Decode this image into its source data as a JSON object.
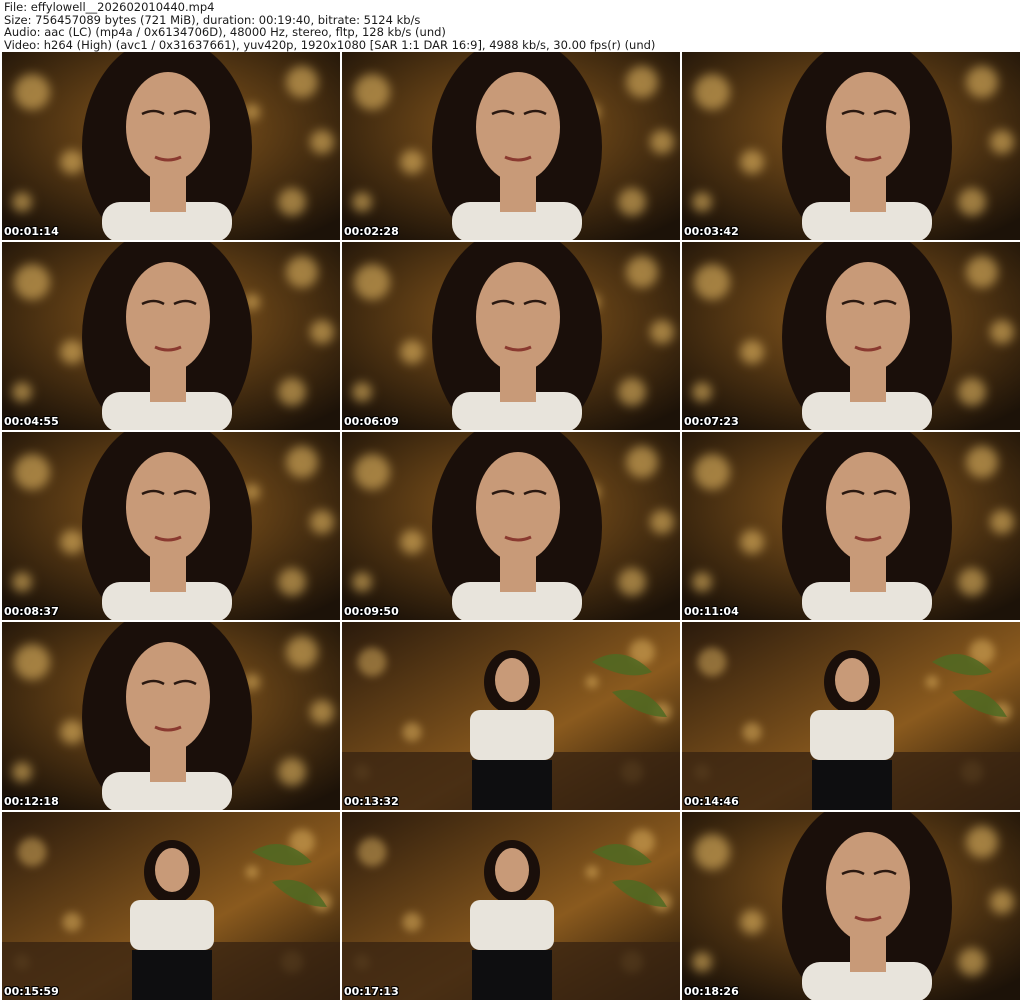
{
  "header": {
    "file_line": "File: effylowell__202602010440.mp4",
    "size_line": "Size: 756457089 bytes (721 MiB), duration: 00:19:40, bitrate: 5124 kb/s",
    "audio_line": "Audio: aac (LC) (mp4a / 0x6134706D), 48000 Hz, stereo, fltp, 128 kb/s (und)",
    "video_line": "Video: h264 (High) (avc1 / 0x31637661), yuv420p, 1920x1080 [SAR 1:1 DAR 16:9], 4988 kb/s, 30.00 fps(r) (und)"
  },
  "thumbnails": [
    {
      "timestamp": "00:01:14",
      "scene": "closeup"
    },
    {
      "timestamp": "00:02:28",
      "scene": "closeup"
    },
    {
      "timestamp": "00:03:42",
      "scene": "closeup"
    },
    {
      "timestamp": "00:04:55",
      "scene": "closeup"
    },
    {
      "timestamp": "00:06:09",
      "scene": "closeup"
    },
    {
      "timestamp": "00:07:23",
      "scene": "closeup"
    },
    {
      "timestamp": "00:08:37",
      "scene": "closeup"
    },
    {
      "timestamp": "00:09:50",
      "scene": "closeup"
    },
    {
      "timestamp": "00:11:04",
      "scene": "closeup"
    },
    {
      "timestamp": "00:12:18",
      "scene": "closeup"
    },
    {
      "timestamp": "00:13:32",
      "scene": "wide"
    },
    {
      "timestamp": "00:14:46",
      "scene": "wide"
    },
    {
      "timestamp": "00:15:59",
      "scene": "wide"
    },
    {
      "timestamp": "00:17:13",
      "scene": "wide"
    },
    {
      "timestamp": "00:18:26",
      "scene": "closeup"
    }
  ],
  "colors": {
    "background": "#ffffff",
    "header_text": "#1a1a1a",
    "timestamp_text": "#ffffff",
    "scene_dark": "#1c1208",
    "scene_warm": "#8a5a1e",
    "bokeh": "#f2c56a",
    "hair": "#1a0f0a",
    "skin": "#c89a78",
    "top_white": "#e8e4dc"
  }
}
